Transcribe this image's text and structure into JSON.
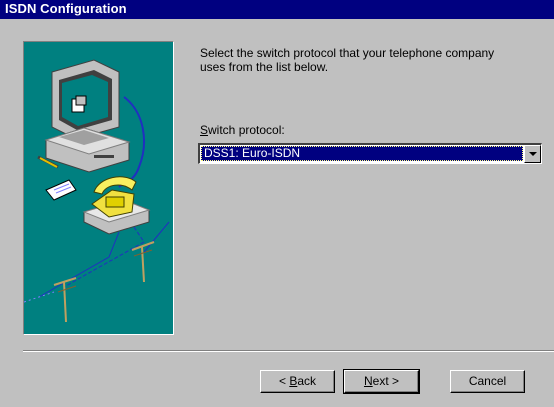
{
  "window": {
    "title": "ISDN Configuration"
  },
  "main": {
    "instruction": "Select the switch protocol that your telephone company\nuses from the list below.",
    "switch_label_accel": "S",
    "switch_label_rest": "witch protocol:",
    "switch_value": "DSS1: Euro-ISDN"
  },
  "buttons": {
    "back_prefix": "< ",
    "back_accel": "B",
    "back_rest": "ack",
    "next_accel": "N",
    "next_rest": "ext >",
    "cancel": "Cancel"
  },
  "colors": {
    "titlebar": "#000080",
    "face": "#c0c0c0",
    "illustration_bg": "#008080"
  },
  "icons": {
    "illustration": "computer-phone-isdn-illustration",
    "dropdown": "chevron-down-icon"
  }
}
